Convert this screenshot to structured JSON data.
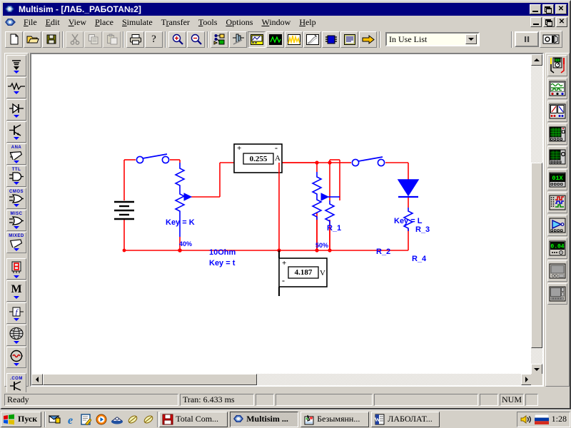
{
  "window": {
    "app_name": "Multisim",
    "document_title": "[ЛАБ._РАБОТА№2]",
    "title": "Multisim - [ЛАБ._РАБОТА№2]",
    "titlebar_color": "#000080",
    "face_color": "#d4d0c8"
  },
  "window_controls": {
    "minimize": "_",
    "maximize": "□",
    "restore": "❐",
    "close": "✕"
  },
  "menu": {
    "items": [
      {
        "label": "File",
        "accel": "F"
      },
      {
        "label": "Edit",
        "accel": "E"
      },
      {
        "label": "View",
        "accel": "V"
      },
      {
        "label": "Place",
        "accel": "P"
      },
      {
        "label": "Simulate",
        "accel": "S"
      },
      {
        "label": "Transfer",
        "accel": "r"
      },
      {
        "label": "Tools",
        "accel": "T"
      },
      {
        "label": "Options",
        "accel": "O"
      },
      {
        "label": "Window",
        "accel": "W"
      },
      {
        "label": "Help",
        "accel": "H"
      }
    ]
  },
  "toolbar": {
    "buttons": [
      {
        "name": "new-file-button",
        "icon": "new-document-icon",
        "enabled": true
      },
      {
        "name": "open-file-button",
        "icon": "open-folder-icon",
        "enabled": true
      },
      {
        "name": "save-file-button",
        "icon": "floppy-disk-icon",
        "enabled": true
      },
      {
        "name": "cut-button",
        "icon": "scissors-icon",
        "enabled": false
      },
      {
        "name": "copy-button",
        "icon": "copy-icon",
        "enabled": false
      },
      {
        "name": "paste-button",
        "icon": "clipboard-icon",
        "enabled": false
      },
      {
        "name": "print-button",
        "icon": "printer-icon",
        "enabled": true
      },
      {
        "name": "help-button",
        "icon": "question-mark-icon",
        "enabled": true
      },
      {
        "name": "zoom-in-button",
        "icon": "magnifier-plus-icon",
        "enabled": true
      },
      {
        "name": "zoom-out-button",
        "icon": "magnifier-minus-icon",
        "enabled": true
      },
      {
        "name": "database-button",
        "icon": "component-database-icon",
        "enabled": true
      },
      {
        "name": "edit-component-button",
        "icon": "component-edit-icon",
        "enabled": true
      },
      {
        "name": "instruments-button",
        "icon": "instrument-panel-icon",
        "enabled": true
      },
      {
        "name": "analysis-button",
        "icon": "waveform-green-icon",
        "enabled": true
      },
      {
        "name": "postprocessor-button",
        "icon": "waveform-yellow-icon",
        "enabled": true
      },
      {
        "name": "simulate-switch-button",
        "icon": "curve-icon",
        "enabled": true
      },
      {
        "name": "subcircuit-button",
        "icon": "chip-blue-icon",
        "enabled": true
      },
      {
        "name": "report-button",
        "icon": "report-lines-icon",
        "enabled": true
      },
      {
        "name": "transfer-button",
        "icon": "yellow-arrow-icon",
        "enabled": true
      }
    ],
    "in_use_list": {
      "label": "In Use List",
      "value": "In Use List"
    },
    "run_pause_button": "⏸",
    "sim_switch_button": "sim-switch-icon"
  },
  "component_palette": {
    "items": [
      {
        "name": "sources",
        "label": "",
        "icon": "ground-source-icon"
      },
      {
        "name": "basic",
        "label": "",
        "icon": "resistor-icon"
      },
      {
        "name": "diodes",
        "label": "",
        "icon": "diode-icon"
      },
      {
        "name": "transistors",
        "label": "",
        "icon": "transistor-icon"
      },
      {
        "name": "analog-ics",
        "label": "ANA",
        "icon": "opamp-icon"
      },
      {
        "name": "ttl",
        "label": "TTL",
        "icon": "logic-gate-icon"
      },
      {
        "name": "cmos",
        "label": "CMOS",
        "icon": "logic-gate-icon"
      },
      {
        "name": "misc-digital",
        "label": "MISC",
        "icon": "logic-gate-icon"
      },
      {
        "name": "mixed-ics",
        "label": "MIXED",
        "icon": "mixed-chip-icon"
      },
      {
        "name": "indicators",
        "label": "",
        "icon": "seven-segment-icon"
      },
      {
        "name": "miscellaneous",
        "label": "M",
        "icon": "letter-m-icon"
      },
      {
        "name": "controls",
        "label": "f",
        "icon": "transfer-function-icon"
      },
      {
        "name": "rf",
        "label": "",
        "icon": "rf-globe-icon"
      },
      {
        "name": "electromechanical",
        "label": "",
        "icon": "relay-coil-icon"
      },
      {
        "name": "edu-web",
        "label": ".COM",
        "icon": "web-component-icon"
      }
    ]
  },
  "instrument_palette": {
    "items": [
      {
        "name": "multimeter",
        "icon": "multimeter-icon"
      },
      {
        "name": "function-generator",
        "icon": "function-generator-icon"
      },
      {
        "name": "wattmeter",
        "icon": "wattmeter-icon"
      },
      {
        "name": "oscilloscope",
        "icon": "oscilloscope-icon"
      },
      {
        "name": "bode-plotter",
        "icon": "bode-plotter-icon"
      },
      {
        "name": "word-generator",
        "icon": "word-generator-icon"
      },
      {
        "name": "logic-analyzer",
        "icon": "logic-analyzer-icon"
      },
      {
        "name": "logic-converter",
        "icon": "logic-converter-icon"
      },
      {
        "name": "distortion-analyzer",
        "icon": "distortion-analyzer-icon"
      },
      {
        "name": "spectrum-analyzer",
        "icon": "spectrum-analyzer-icon"
      },
      {
        "name": "network-analyzer",
        "icon": "network-analyzer-icon"
      }
    ]
  },
  "schematic": {
    "background": "#ffffff",
    "wire_color": "#ff0000",
    "component_color": "#0000ff",
    "components": [
      {
        "name": "battery",
        "ref": "",
        "value": ""
      },
      {
        "name": "switch-k",
        "ref": "",
        "value": "Key = K"
      },
      {
        "name": "potentiometer-1",
        "ref": "",
        "value": "10Ohm",
        "key": "Key = t",
        "percent": "40%"
      },
      {
        "name": "potentiometer-2",
        "ref": "R_1",
        "value": "",
        "percent": "50%"
      },
      {
        "name": "resistor-r2",
        "ref": "R_2",
        "value": ""
      },
      {
        "name": "switch-l",
        "ref": "",
        "value": "Key = L"
      },
      {
        "name": "diode-r3",
        "ref": "R_3",
        "value": ""
      },
      {
        "name": "resistor-r4",
        "ref": "R_4",
        "value": ""
      }
    ],
    "ammeter": {
      "reading": "0.255",
      "unit": "A",
      "plus": "+",
      "minus": "-"
    },
    "voltmeter": {
      "reading": "4.187",
      "unit": "V",
      "plus": "+",
      "minus": "-"
    }
  },
  "status_bar": {
    "message": "Ready",
    "transient": "Tran: 6.433 ms",
    "panel3": "",
    "panel4": "",
    "panel5": "",
    "num_lock": "NUM",
    "panel7": ""
  },
  "taskbar": {
    "start_label": "Пуск",
    "quick_launch": [
      {
        "name": "show-desktop-icon"
      },
      {
        "name": "internet-explorer-icon"
      },
      {
        "name": "notepad-icon"
      },
      {
        "name": "media-player-icon"
      },
      {
        "name": "outlook-express-icon"
      },
      {
        "name": "channel-icon-1"
      },
      {
        "name": "channel-icon-2"
      }
    ],
    "tasks": [
      {
        "label": "Total Com...",
        "icon": "total-commander-icon",
        "active": false
      },
      {
        "label": "Multisim ...",
        "icon": "multisim-icon",
        "active": true
      },
      {
        "label": "Безымянн...",
        "icon": "paint-icon",
        "active": false
      },
      {
        "label": "ЛАБОЛАТ...",
        "icon": "word-icon",
        "active": false
      }
    ],
    "tray": {
      "volume_icon": "speaker-icon",
      "language_icon": "russian-flag-icon",
      "clock": "1:28"
    }
  }
}
